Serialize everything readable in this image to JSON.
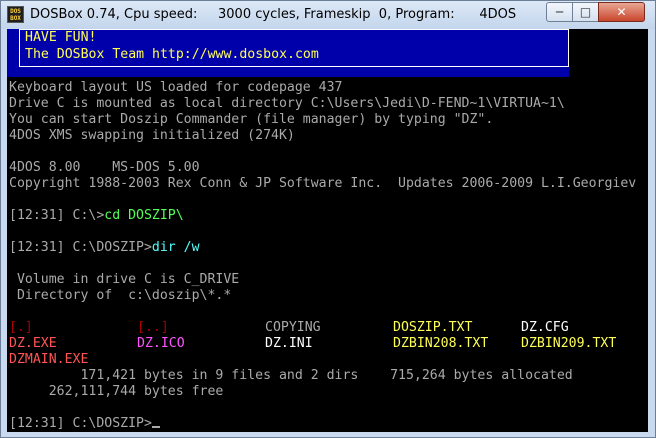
{
  "window": {
    "title": "DOSBox 0.74, Cpu speed:     3000 cycles, Frameskip  0, Program:      4DOS",
    "icon_text": "DOS BOX",
    "controls": {
      "minimize": "─",
      "maximize": "□",
      "close": "✕"
    }
  },
  "banner": {
    "line1": "HAVE FUN!",
    "line2": "The DOSBox Team http://www.dosbox.com"
  },
  "console": {
    "lines": [
      "Keyboard layout US loaded for codepage 437",
      "Drive C is mounted as local directory C:\\Users\\Jedi\\D-FEND~1\\VIRTUA~1\\",
      "You can start Doszip Commander (file manager) by typing \"DZ\".",
      "4DOS XMS swapping initialized (274K)",
      "4DOS 8.00    MS-DOS 5.00",
      "Copyright 1988-2003 Rex Conn & JP Software Inc.  Updates 2006-2009 L.I.Georgiev"
    ],
    "cmd1_prompt": "[12:31] C:\\>",
    "cmd1_input": "cd DOSZIP\\",
    "cmd2_prompt": "[12:31] C:\\DOSZIP>",
    "cmd2_input": "dir /w",
    "volume": " Volume in drive C is C_DRIVE",
    "directory": " Directory of  c:\\doszip\\*.*",
    "files_row1": [
      "[.]",
      "[..]",
      "COPYING",
      "DOSZIP.TXT",
      "DZ.CFG"
    ],
    "files_row2": [
      "DZ.EXE",
      "DZ.ICO",
      "DZ.INI",
      "DZBIN208.TXT",
      "DZBIN209.TXT"
    ],
    "files_row3": [
      "DZMAIN.EXE"
    ],
    "summary1": "         171,421 bytes in 9 files and 2 dirs    715,264 bytes allocated",
    "summary2": "     262,111,744 bytes free",
    "final_prompt": "[12:31] C:\\DOSZIP>"
  },
  "colors": {
    "banner_bg": "#0000aa",
    "text_default": "#aaaaaa",
    "input_green": "#55ff55",
    "input_cyan": "#55ffff",
    "dir_red": "#aa0000",
    "exe_red": "#ff5555",
    "ico_magenta": "#ff55ff",
    "txt_yellow": "#ffff55"
  }
}
